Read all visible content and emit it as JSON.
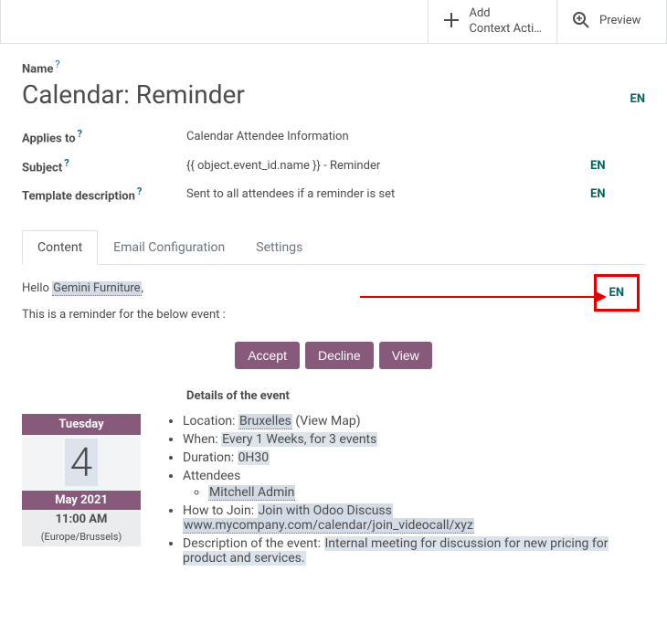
{
  "toolbar": {
    "add_label_line1": "Add",
    "add_label_line2": "Context Acti…",
    "preview_label": "Preview"
  },
  "labels": {
    "name": "Name",
    "applies_to": "Applies to",
    "subject": "Subject",
    "template_desc": "Template description",
    "en": "EN",
    "help": "?"
  },
  "values": {
    "name": "Calendar: Reminder",
    "applies_to": "Calendar Attendee Information",
    "subject": "{{ object.event_id.name }} - Reminder",
    "template_desc": "Sent to all attendees if a reminder is set"
  },
  "tabs": {
    "content": "Content",
    "email_config": "Email Configuration",
    "settings": "Settings"
  },
  "body": {
    "hello": "Hello ",
    "recipient": "Gemini Furniture",
    "comma": ",",
    "reminder_line": "This is a reminder for the below event :",
    "accept": "Accept",
    "decline": "Decline",
    "view": "View",
    "details_header": "Details of the event"
  },
  "calendar": {
    "weekday": "Tuesday",
    "day": "4",
    "month_year": "May 2021",
    "time": "11:00 AM",
    "tz": "(Europe/Brussels)"
  },
  "details": {
    "location_lbl": "Location: ",
    "location_val": "Bruxelles",
    "view_map": " (View Map)",
    "when_lbl": "When: ",
    "when_val": "Every 1 Weeks, for 3 events",
    "duration_lbl": "Duration: ",
    "duration_val": "0H30",
    "attendees_lbl": "Attendees",
    "attendee1": "Mitchell Admin",
    "howto_lbl": "How to Join: ",
    "howto_val": "Join with Odoo Discuss",
    "howto_url": "www.mycompany.com/calendar/join_videocall/xyz",
    "desc_lbl": "Description of the event: ",
    "desc_val": "Internal meeting for discussion for new pricing for product and services."
  }
}
